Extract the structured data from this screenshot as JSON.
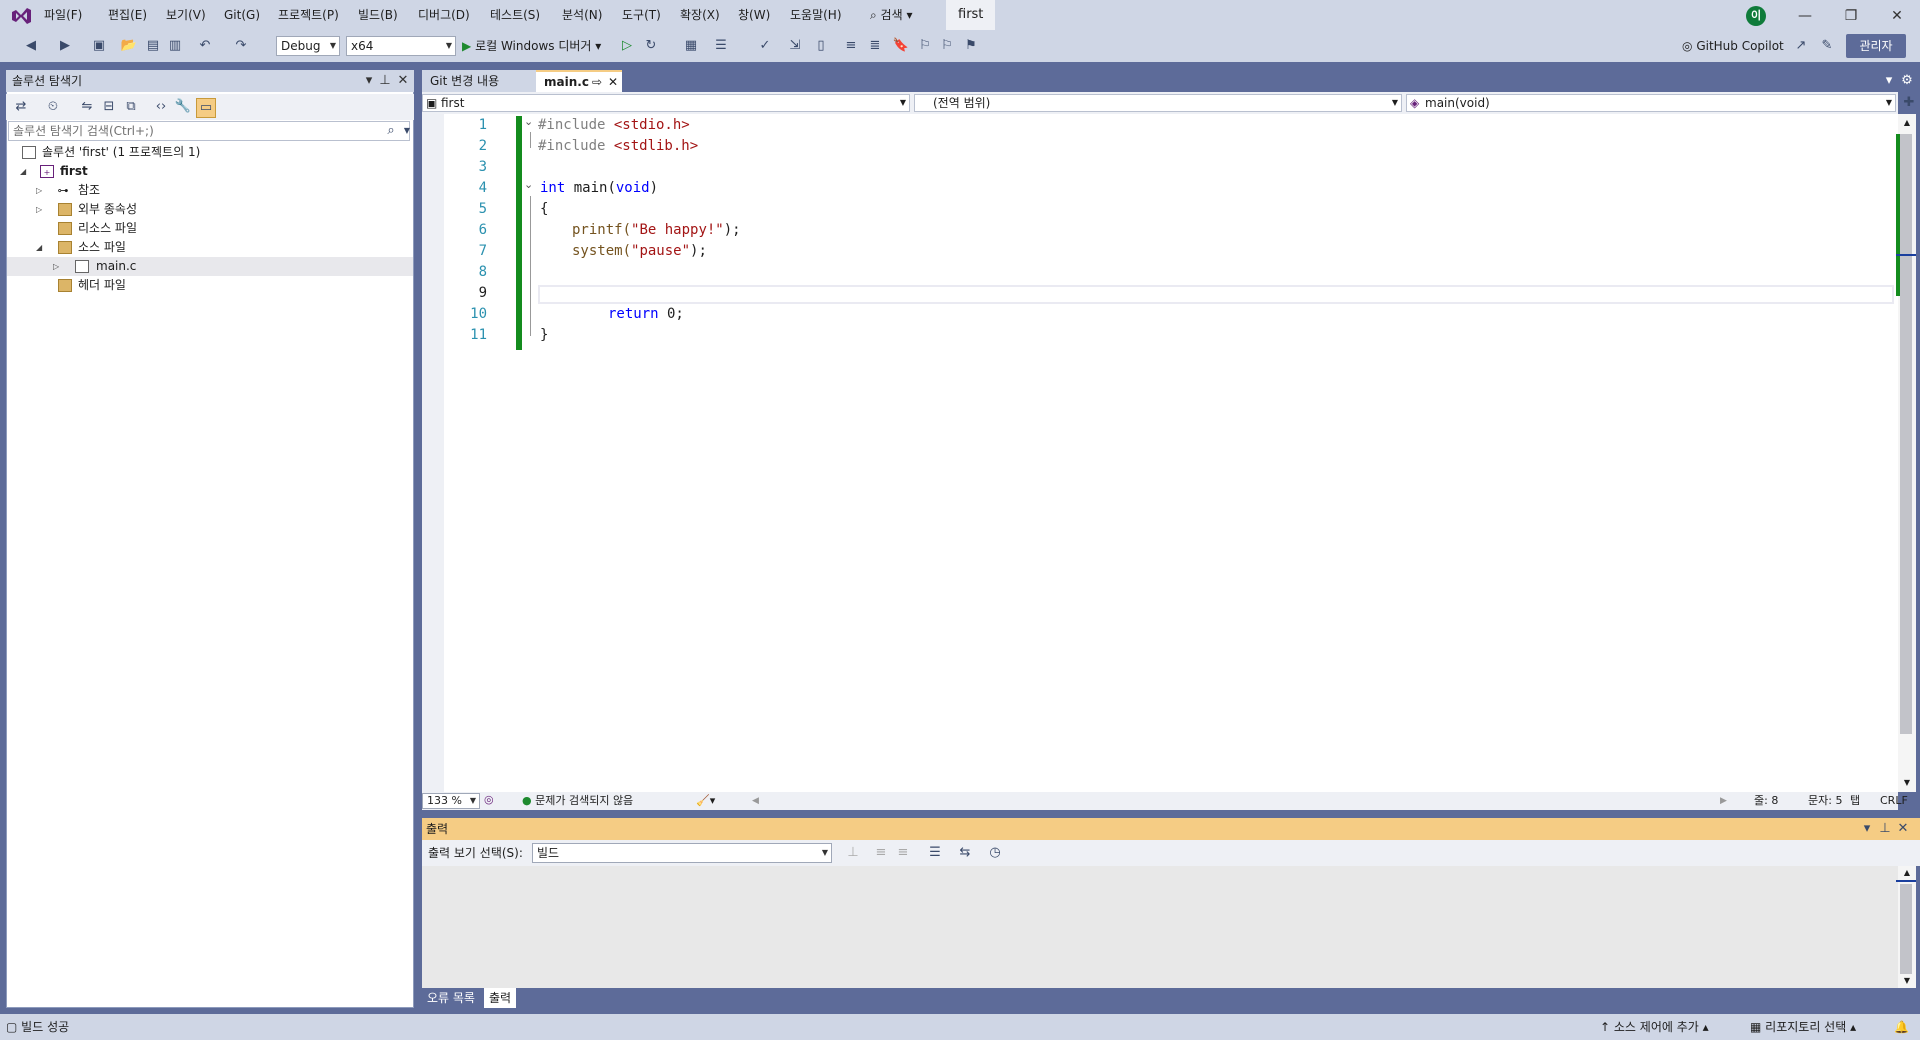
{
  "menu": {
    "items": [
      "파일(F)",
      "편집(E)",
      "보기(V)",
      "Git(G)",
      "프로젝트(P)",
      "빌드(B)",
      "디버그(D)",
      "테스트(S)",
      "분석(N)",
      "도구(T)",
      "확장(X)",
      "창(W)",
      "도움말(H)"
    ],
    "search_label": "검색",
    "solution_name": "first",
    "profile_initial": "이"
  },
  "toolbar": {
    "config": "Debug",
    "platform": "x64",
    "run_label": "로컬 Windows 디버거",
    "copilot_label": "GitHub Copilot",
    "admin_label": "관리자"
  },
  "solution_explorer": {
    "title": "솔루션 탐색기",
    "search_placeholder": "솔루션 탐색기 검색(Ctrl+;)",
    "tree": [
      {
        "label": "솔루션 'first' (1 프로젝트의 1)",
        "depth": 0
      },
      {
        "label": "first",
        "depth": 1,
        "bold": true
      },
      {
        "label": "참조",
        "depth": 2
      },
      {
        "label": "외부 종속성",
        "depth": 2
      },
      {
        "label": "리소스 파일",
        "depth": 2
      },
      {
        "label": "소스 파일",
        "depth": 2
      },
      {
        "label": "main.c",
        "depth": 3
      },
      {
        "label": "헤더 파일",
        "depth": 2
      }
    ]
  },
  "editor": {
    "tabs": [
      {
        "label": "Git 변경 내용",
        "active": false
      },
      {
        "label": "main.c",
        "active": true
      }
    ],
    "nav": {
      "project": "first",
      "scope": "(전역 범위)",
      "member": "main(void)"
    },
    "line_numbers": [
      "1",
      "2",
      "3",
      "4",
      "5",
      "6",
      "7",
      "8",
      "9",
      "10",
      "11"
    ],
    "lines": {
      "l1_pp": "#include ",
      "l1_hdr": "<stdio.h>",
      "l2_pp": "#include ",
      "l2_hdr": "<stdlib.h>",
      "l4_kw": "int",
      "l4_rest": " main(",
      "l4_kw2": "void",
      "l4_end": ")",
      "l5": "{",
      "l6_fn": "printf(",
      "l6_str": "\"Be happy!\"",
      "l6_end": ");",
      "l7_fn": "system(",
      "l7_str": "\"pause\"",
      "l7_end": ");",
      "l10_kw": "return",
      "l10_rest": " 0;",
      "l11": "}"
    },
    "status": {
      "zoom": "133 %",
      "issues": "문제가 검색되지 않음",
      "line": "줄: 8",
      "char": "문자: 5",
      "tab": "탭",
      "eol": "CRLF"
    }
  },
  "output": {
    "title": "출력",
    "select_label": "출력 보기 선택(S):",
    "select_value": "빌드",
    "bottom_tabs": [
      "오류 목록",
      "출력"
    ]
  },
  "statusbar": {
    "build": "빌드 성공",
    "source_control": "소스 제어에 추가",
    "repo": "리포지토리 선택"
  },
  "colors": {
    "accent": "#5d6b99",
    "chrome": "#cfd6e5",
    "output_header": "#f5cc84",
    "change_bar": "#148c1e"
  }
}
